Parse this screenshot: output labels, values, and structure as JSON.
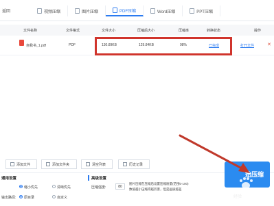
{
  "topbar": {
    "back_label": "返回",
    "tabs": [
      {
        "label": "视频压缩",
        "icon": "video-icon",
        "active": false
      },
      {
        "label": "图片压缩",
        "icon": "image-icon",
        "active": false
      },
      {
        "label": "PDF压缩",
        "icon": "pdf-icon",
        "active": true
      },
      {
        "label": "Word压缩",
        "icon": "word-icon",
        "active": false
      },
      {
        "label": "PPT压缩",
        "icon": "ppt-icon",
        "active": false
      }
    ]
  },
  "table": {
    "headers": {
      "name": "文件名称",
      "format": "文件格式",
      "size": "文件大小",
      "compressed_size": "压缩后大小",
      "ratio": "压缩率",
      "status": "转换状态",
      "action": "操作"
    },
    "rows": [
      {
        "name": "自我书_1.pdf",
        "format": "PDF",
        "size": "130.89KB",
        "compressed_size": "129.84KB",
        "ratio": "98%",
        "status": "已完成",
        "action": "打开文件"
      }
    ]
  },
  "toolbar": {
    "add_file": "添加文件",
    "add_folder": "添加文件夹",
    "clear_list": "清空列表",
    "history": "历史记录"
  },
  "settings": {
    "general_title": "通用设置",
    "advanced_title": "高级设置",
    "mode_options": [
      "缩小优先",
      "清晰优先"
    ],
    "output_path_label": "输出路径:",
    "output_options": [
      "原目录",
      "自定义"
    ],
    "quality_label": "压缩强度:",
    "quality_value": "80",
    "quality_hint_1": "图片压缩在压缩后设置压缩质量(范围0-100)",
    "quality_hint_2": "数值越小压缩得越厉害，但是画质越差"
  },
  "compress_button": {
    "label": "始压缩"
  },
  "watermark": {
    "text": "经验"
  },
  "colors": {
    "accent": "#2b7bf0",
    "highlight": "#d0342c",
    "arrow": "#c0392b"
  }
}
